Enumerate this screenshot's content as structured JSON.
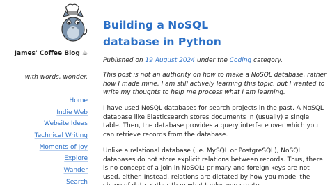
{
  "sidebar": {
    "blog_title": "James' Coffee Blog ☕",
    "tagline": "with words, wonder.",
    "nav": [
      {
        "label": "Home"
      },
      {
        "label": "Indie Web"
      },
      {
        "label": "Website Ideas"
      },
      {
        "label": "Technical Writing"
      },
      {
        "label": "Moments of Joy"
      },
      {
        "label": "Explore"
      },
      {
        "label": "Wander"
      },
      {
        "label": "Search"
      }
    ]
  },
  "post": {
    "title": "Building a NoSQL database in Python",
    "meta_prefix": "Published on ",
    "date": "19 August 2024",
    "meta_middle": " under the ",
    "category": "Coding",
    "meta_suffix": " category.",
    "note": "This post is not an authority on how to make a NoSQL database, rather how I made mine. I am still actively learning this topic, but I wanted to write my thoughts to help me process what I am learning.",
    "paragraphs": [
      "I have used NoSQL databases for search projects in the past. A NoSQL database like Elasticsearch stores documents in (usually) a single table. Then, the database provides a query interface over which you can retrieve records from the database.",
      "Unlike a relational database (i.e. MySQL or PostgreSQL), NoSQL databases do not store explicit relations between records. Thus, there is no concept of a join in NoSQL; primary and foreign keys are not used, either. Instead, relations are dictated by how you model the shape of data, rather than what tables you create."
    ]
  },
  "colors": {
    "link": "#2b6fc7",
    "title": "#2a6fc6",
    "text": "#1f1f1f"
  }
}
